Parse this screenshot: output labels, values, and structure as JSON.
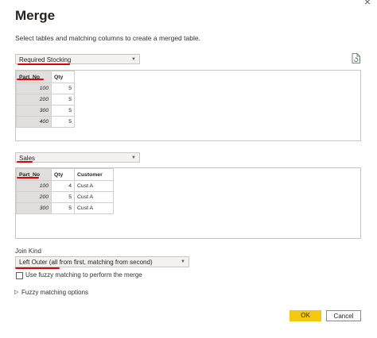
{
  "dialog": {
    "title": "Merge",
    "subtitle": "Select tables and matching columns to create a merged table.",
    "close_icon": "×"
  },
  "table1": {
    "selected": "Required Stocking",
    "columns": [
      "Part_No",
      "Qty"
    ],
    "rows": [
      [
        "100",
        "5"
      ],
      [
        "200",
        "5"
      ],
      [
        "300",
        "5"
      ],
      [
        "400",
        "5"
      ]
    ]
  },
  "table2": {
    "selected": "Sales",
    "columns": [
      "Part_No",
      "Qty",
      "Customer"
    ],
    "rows": [
      [
        "100",
        "4",
        "Cust A"
      ],
      [
        "200",
        "5",
        "Cust A"
      ],
      [
        "300",
        "5",
        "Cust A"
      ]
    ]
  },
  "join": {
    "label": "Join Kind",
    "selected": "Left Outer (all from first, matching from second)"
  },
  "fuzzy": {
    "checkbox_label": "Use fuzzy matching to perform the merge",
    "checked": false,
    "options_label": "Fuzzy matching options",
    "expander_icon": "▷"
  },
  "buttons": {
    "ok": "OK",
    "cancel": "Cancel"
  },
  "colors": {
    "accent": "#f2c811",
    "annotation": "#e00000",
    "key_column": "#e1dfdd"
  },
  "icons": {
    "file": "file-refresh-icon",
    "dropdown": "chevron-down-icon"
  }
}
